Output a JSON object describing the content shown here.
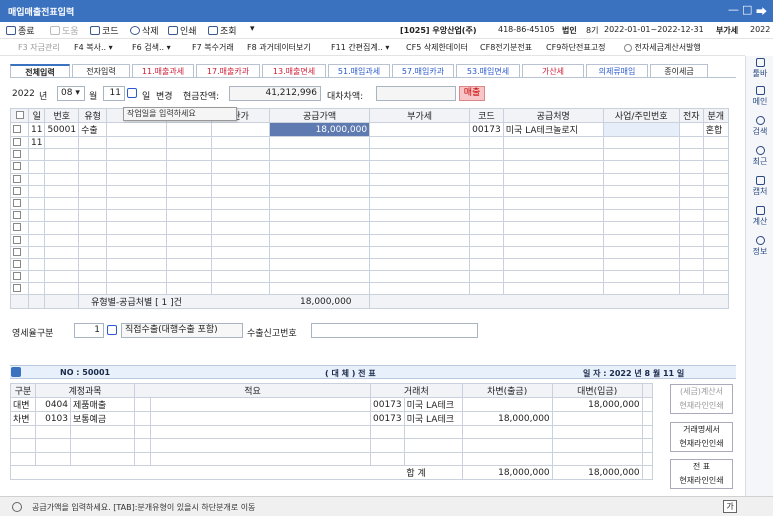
{
  "window": {
    "title": "매입매출전표입력",
    "minimize": "—",
    "maximize": "□",
    "close": "⮕"
  },
  "toolbar": {
    "items": [
      {
        "label": "종료"
      },
      {
        "label": "도움"
      },
      {
        "label": "코드"
      },
      {
        "label": "삭제"
      },
      {
        "label": "인쇄"
      },
      {
        "label": "조회"
      },
      {
        "label": "▾"
      }
    ],
    "company": "[1025] 우앙산업(주)",
    "bizno": "418-86-45105",
    "type": "법인",
    "period_no": "8기",
    "period": "2022-01-01~2022-12-31",
    "vat": "부가세",
    "year": "2022"
  },
  "fkeys": [
    {
      "label": "F3 자금관리"
    },
    {
      "label": "F4 복사.. ▾"
    },
    {
      "label": "F6 검색.. ▾"
    },
    {
      "label": "F7 복수거래"
    },
    {
      "label": "F8 과거데이터보기"
    },
    {
      "label": "F11 간편집계.. ▾"
    },
    {
      "label": "CF5 삭제한데이터"
    },
    {
      "label": "CF8전기분전표"
    },
    {
      "label": "CF9하단전표고정"
    },
    {
      "label": "전자세금계산서발행"
    }
  ],
  "sidebar": [
    {
      "label": "툴바"
    },
    {
      "label": "메인"
    },
    {
      "label": "검색"
    },
    {
      "label": "최근"
    },
    {
      "label": "캡처"
    },
    {
      "label": "계산"
    },
    {
      "label": "정보"
    }
  ],
  "tabs": [
    {
      "label": "전체입력"
    },
    {
      "label": "전자입력"
    },
    {
      "label": "11.매출과세"
    },
    {
      "label": "17.매출카과"
    },
    {
      "label": "13.매출면세"
    },
    {
      "label": "51.매입과세"
    },
    {
      "label": "57.매입카과"
    },
    {
      "label": "53.매입면세"
    },
    {
      "label": "가산세"
    },
    {
      "label": "의제류매입"
    },
    {
      "label": "종이세금"
    }
  ],
  "filter": {
    "year": "2022",
    "year_label": "년",
    "month": "08",
    "month_label": "월",
    "day": "11",
    "day_label": "일",
    "change": "변경",
    "cash_label": "현금잔액:",
    "cash_value": "41,212,996",
    "diff_label": "대차차액:",
    "diff_value": "",
    "mode": "매출"
  },
  "tooltip": "작업일을 입력하세요",
  "grid": {
    "headers": [
      "",
      "일",
      "번호",
      "유형",
      "품목",
      "수량",
      "단가",
      "공급가액",
      "부가세",
      "코드",
      "공급처명",
      "사업/주민번호",
      "전자",
      "분개"
    ],
    "rows": [
      [
        "",
        "11",
        "50001",
        "수출",
        "",
        "",
        "",
        "18,000,000",
        "",
        "00173",
        "미국 LA테크놀로지",
        "",
        "",
        "혼합"
      ],
      [
        "",
        "11",
        "",
        "",
        "",
        "",
        "",
        "",
        "",
        "",
        "",
        "",
        "",
        ""
      ]
    ],
    "footer_label": "유형별-공급처별 [ 1 ]건",
    "footer_amount": "18,000,000"
  },
  "zero_rate": {
    "label": "영세율구분",
    "value": "1",
    "desc": "직접수출(대행수출 포함)",
    "export_label": "수출신고번호",
    "export_value": ""
  },
  "voucher": {
    "no_label": "NO : 50001",
    "title": "( 대 체 ) 전 표",
    "date": "일 자 : 2022 년  8 월 11 일",
    "headers": [
      "구분",
      "계정과목",
      "적요",
      "거래처",
      "차변(출금)",
      "대변(입금)"
    ],
    "rows": [
      {
        "kind": "대변",
        "code": "0404",
        "account": "제품매출",
        "memo": "",
        "pcode": "00173",
        "partner": "미국 LA테크",
        "debit": "",
        "credit": "18,000,000"
      },
      {
        "kind": "차변",
        "code": "0103",
        "account": "보통예금",
        "memo": "",
        "pcode": "00173",
        "partner": "미국 LA테크",
        "debit": "18,000,000",
        "credit": ""
      }
    ],
    "total_label": "합  계",
    "total_debit": "18,000,000",
    "total_credit": "18,000,000"
  },
  "print_buttons": [
    {
      "l1": "(세금)계산서",
      "l2": "현재라인인쇄"
    },
    {
      "l1": "거래명세서",
      "l2": "현재라인인쇄"
    },
    {
      "l1": "전   표",
      "l2": "현재라인인쇄"
    }
  ],
  "status": {
    "text": "공급가액을 입력하세요.  [TAB]:분개유형이 있을시 하단분개로 이동",
    "mode": "가"
  }
}
